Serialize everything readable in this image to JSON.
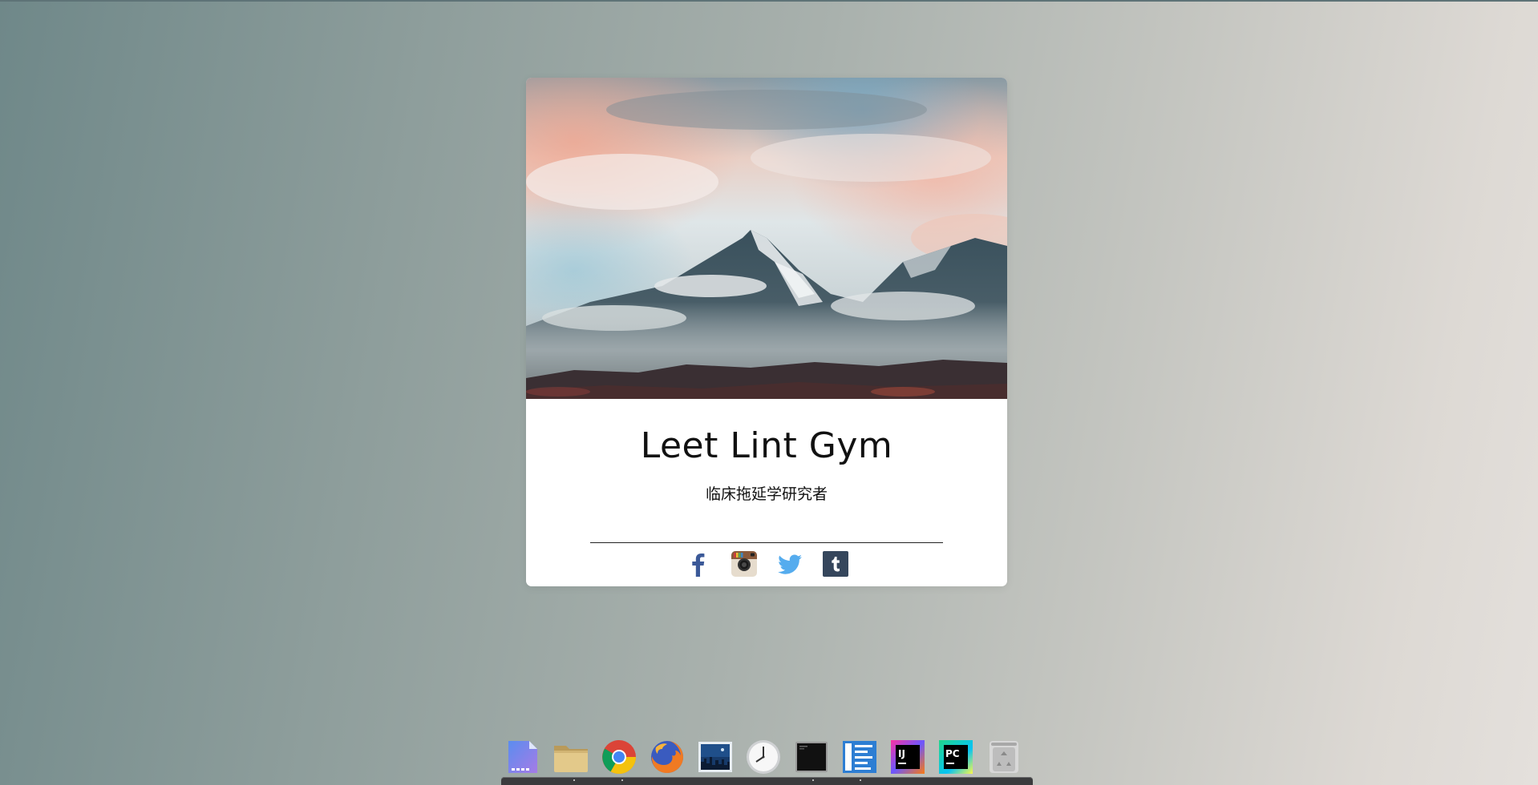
{
  "card": {
    "name": "Leet Lint Gym",
    "subtitle": "临床拖延学研究者"
  },
  "socials": [
    {
      "name": "facebook",
      "icon": "facebook-icon",
      "color": "#3b5998"
    },
    {
      "name": "instagram",
      "icon": "instagram-icon",
      "color": "#c9a98a"
    },
    {
      "name": "twitter",
      "icon": "twitter-icon",
      "color": "#55acee"
    },
    {
      "name": "tumblr",
      "icon": "tumblr-icon",
      "color": "#35465c"
    }
  ],
  "dock": {
    "items": [
      {
        "name": "text-editor",
        "icon": "document-icon"
      },
      {
        "name": "file-manager",
        "icon": "folder-icon"
      },
      {
        "name": "chrome",
        "icon": "chrome-icon"
      },
      {
        "name": "firefox",
        "icon": "firefox-icon"
      },
      {
        "name": "image-viewer",
        "icon": "image-icon"
      },
      {
        "name": "clock",
        "icon": "clock-icon"
      },
      {
        "name": "terminal",
        "icon": "terminal-icon"
      },
      {
        "name": "text-viewer",
        "icon": "lines-icon"
      },
      {
        "name": "intellij",
        "icon": "intellij-icon",
        "label": "IJ"
      },
      {
        "name": "pycharm",
        "icon": "pycharm-icon",
        "label": "PC"
      },
      {
        "name": "trash",
        "icon": "trash-icon"
      }
    ]
  },
  "colors": {
    "background_start": "#6f8889",
    "background_end": "#e4e0dc",
    "card": "#ffffff",
    "text": "#111111"
  }
}
